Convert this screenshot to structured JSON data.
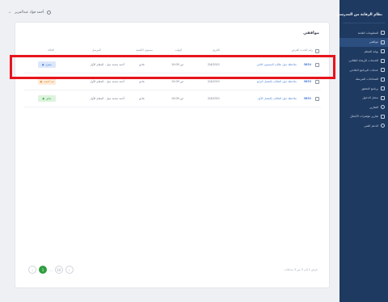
{
  "sidebar": {
    "brand": "نظام الرقابة من المدرسي",
    "items": [
      {
        "label": "المعلومات العامة"
      },
      {
        "label": "مواقفي"
      },
      {
        "label": "بوابة المعلم"
      },
      {
        "label": "الخدمات الإرشاد الطلابي"
      },
      {
        "label": "خدمات البرنامج العلاجي"
      },
      {
        "label": "المحادثات المرسلة"
      },
      {
        "label": "برنامج التحقق"
      },
      {
        "label": "سجل الدخول"
      },
      {
        "label": "التقارير"
      },
      {
        "label": "تقارير مؤشرات الأعمال"
      },
      {
        "label": "الدعم الفني"
      }
    ]
  },
  "topbar": {
    "user": "أحمد فؤاد عبدالعزيز"
  },
  "card": {
    "title": "مواقفي",
    "headers": {
      "select": "",
      "number": "رقم الحدث العرض",
      "subject": "العنوان",
      "date": "التاريخ",
      "time": "الوقت",
      "type": "مستوى الأهمية",
      "owner": "المرسل",
      "status": "الحالة"
    },
    "rows": [
      {
        "id": "3854",
        "subject": "ملاحظة حول طالب المستوى الثاني",
        "date": "2/4/2021",
        "time": "10:00 ص",
        "type": "عادي",
        "owner": "أحمد محمد نبيل - المعلم الأول",
        "status": "مفتوح",
        "status_bg": "#dbe8fb",
        "status_fg": "#4a7fd4"
      },
      {
        "id": "3853",
        "subject": "ملاحظة حول الطالب بالفصل الرابع",
        "date": "2/4/2021",
        "time": "10:00 ص",
        "type": "عادي",
        "owner": "أحمد محمد نبيل - المعلم الأول",
        "status": "قيد التنفيذ",
        "status_bg": "#fdebd8",
        "status_fg": "#e08a34"
      },
      {
        "id": "3852",
        "subject": "ملاحظة حول الطالب بالفصل الأول",
        "date": "2/4/2021",
        "time": "10:00 ص",
        "type": "عادي",
        "owner": "أحمد محمد نبيل - المعلم الأول",
        "status": "مغلق",
        "status_bg": "#dcf3dc",
        "status_fg": "#3aa745"
      }
    ],
    "footer_info": "عرض 1 إلى 3 من 3 مدخلات",
    "pager": {
      "prev": "‹",
      "current": "1",
      "next": "›",
      "dots": "...",
      "last": "10"
    }
  },
  "colors": {
    "sidebar": "#1f3a61",
    "accent": "#2e9e3f",
    "highlight": "#e8141b"
  }
}
